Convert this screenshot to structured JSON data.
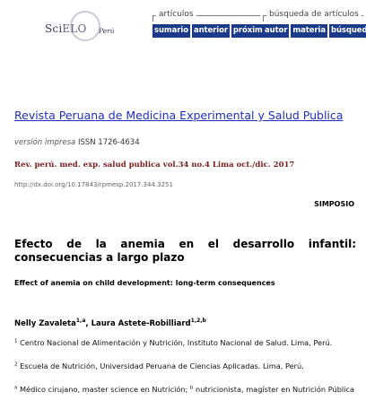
{
  "logo": {
    "brand_a": "Sci",
    "brand_b": "ELO",
    "country": "Perú"
  },
  "nav": {
    "articles_caption": "artículos",
    "articles_buttons": [
      "sumario",
      "anterior",
      "próximo"
    ],
    "search_caption": "búsqueda de artículos",
    "search_buttons": [
      "autor",
      "materia",
      "búsqueda"
    ]
  },
  "journal": {
    "title_link": "Revista Peruana de Medicina Experimental y Salud Publica",
    "version": "versión impresa",
    "issn": "ISSN 1726-4634",
    "citation": "Rev. perú. med. exp. salud publica vol.34 no.4 Lima oct./dic. 2017",
    "doi": "http://dx.doi.org/10.17843/rpmesp.2017.344.3251"
  },
  "article": {
    "section": "SIMPOSIO",
    "title": "Efecto de la anemia en el desarrollo infantil: consecuencias a largo plazo",
    "subtitle": "Effect of anemia on child development: long-term consequences",
    "authors": [
      {
        "name": "Nelly Zavaleta",
        "sup": "1,a"
      },
      {
        "name": "Laura Astete-Robilliard",
        "sup": "1,2,b"
      }
    ],
    "affiliations": [
      {
        "mark": "1",
        "text": "Centro Nacional de Alimentación y Nutrición, Instituto Nacional de Salud. Lima, Perú."
      },
      {
        "mark": "2",
        "text": "Escuela de Nutrición, Universidad Peruana de Ciencias Aplicadas. Lima, Perú."
      }
    ],
    "roles": [
      {
        "mark": "a",
        "text": "Médico cirujano, master science en Nutrición;"
      },
      {
        "mark": "b",
        "text": "nutricionista, magíster en Nutrición Pública"
      }
    ]
  }
}
